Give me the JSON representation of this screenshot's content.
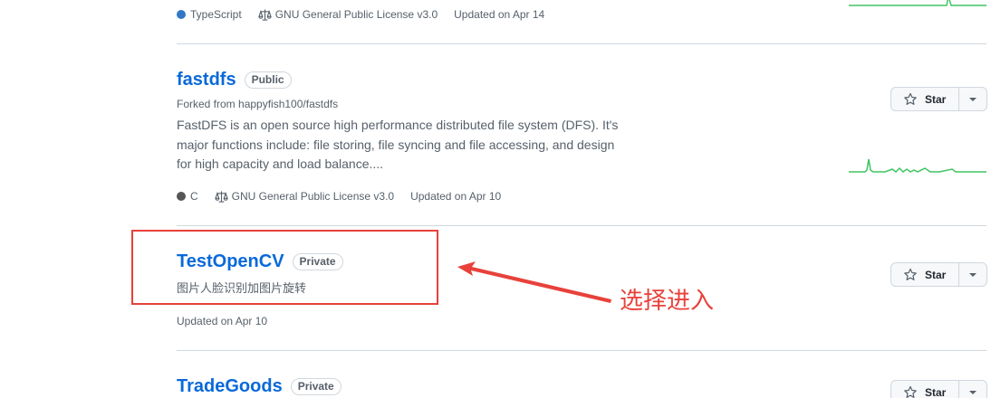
{
  "repos": [
    {
      "language": "TypeScript",
      "language_color": "#3178c6",
      "license": "GNU General Public License v3.0",
      "updated": "Updated on Apr 14"
    },
    {
      "name": "fastdfs",
      "visibility": "Public",
      "forked_from": "Forked from happyfish100/fastdfs",
      "description": "FastDFS is an open source high performance distributed file system (DFS). It's major functions include: file storing, file syncing and file accessing, and design for high capacity and load balance....",
      "language": "C",
      "language_color": "#555555",
      "license": "GNU General Public License v3.0",
      "updated": "Updated on Apr 10",
      "star_label": "Star"
    },
    {
      "name": "TestOpenCV",
      "visibility": "Private",
      "description": "图片人脸识别加图片旋转",
      "updated": "Updated on Apr 10",
      "star_label": "Star"
    },
    {
      "name": "TradeGoods",
      "visibility": "Private",
      "star_label": "Star"
    }
  ],
  "annotation": {
    "text": "选择进入",
    "color": "#e8413b"
  }
}
